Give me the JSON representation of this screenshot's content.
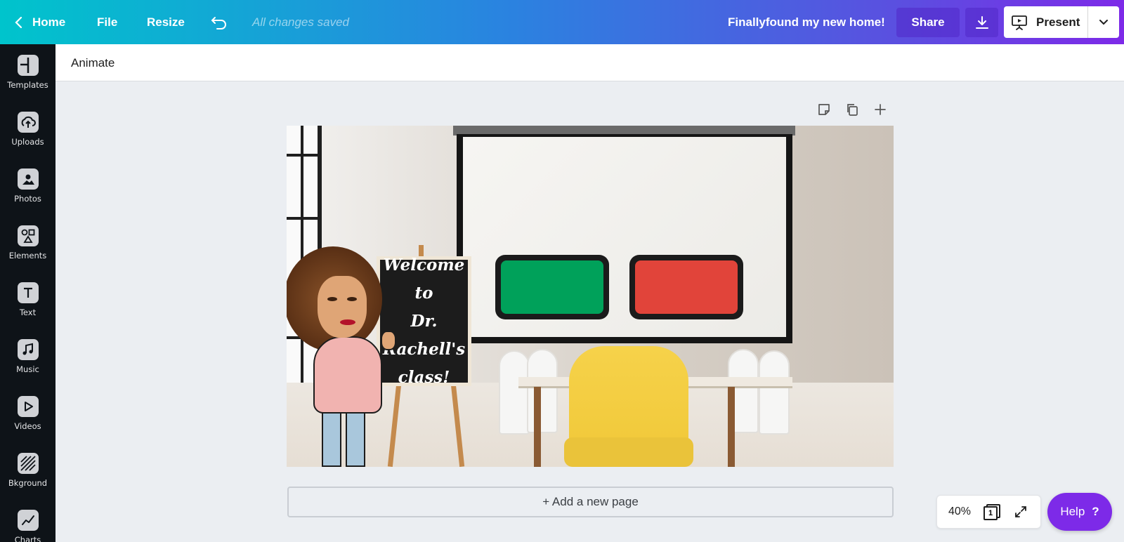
{
  "topbar": {
    "home_label": "Home",
    "file_label": "File",
    "resize_label": "Resize",
    "saved_status": "All changes saved",
    "design_title": "Finallyfound my new home!",
    "share_label": "Share",
    "present_label": "Present"
  },
  "sidebar": {
    "items": [
      {
        "label": "Templates",
        "icon": "templates-icon"
      },
      {
        "label": "Uploads",
        "icon": "upload-cloud-icon"
      },
      {
        "label": "Photos",
        "icon": "photo-icon"
      },
      {
        "label": "Elements",
        "icon": "shapes-icon"
      },
      {
        "label": "Text",
        "icon": "text-icon"
      },
      {
        "label": "Music",
        "icon": "music-note-icon"
      },
      {
        "label": "Videos",
        "icon": "play-icon"
      },
      {
        "label": "Bkground",
        "icon": "background-pattern-icon"
      },
      {
        "label": "Charts",
        "icon": "chart-line-icon"
      }
    ]
  },
  "toolbar": {
    "animate_label": "Animate"
  },
  "canvas": {
    "sign_text_line1": "Welcome to",
    "sign_text_line2": "Dr.",
    "sign_text_line3": "Rachell's",
    "sign_text_line4": "class!"
  },
  "add_page_label": "+ Add a new page",
  "zoom": {
    "level": "40%",
    "page_count": "1"
  },
  "help_label": "Help",
  "help_glyph": "?",
  "colors": {
    "accent_purple": "#7d2ae8",
    "gradient_start": "#00c4cc",
    "green_button": "#00a15a",
    "red_button": "#e1443a"
  }
}
